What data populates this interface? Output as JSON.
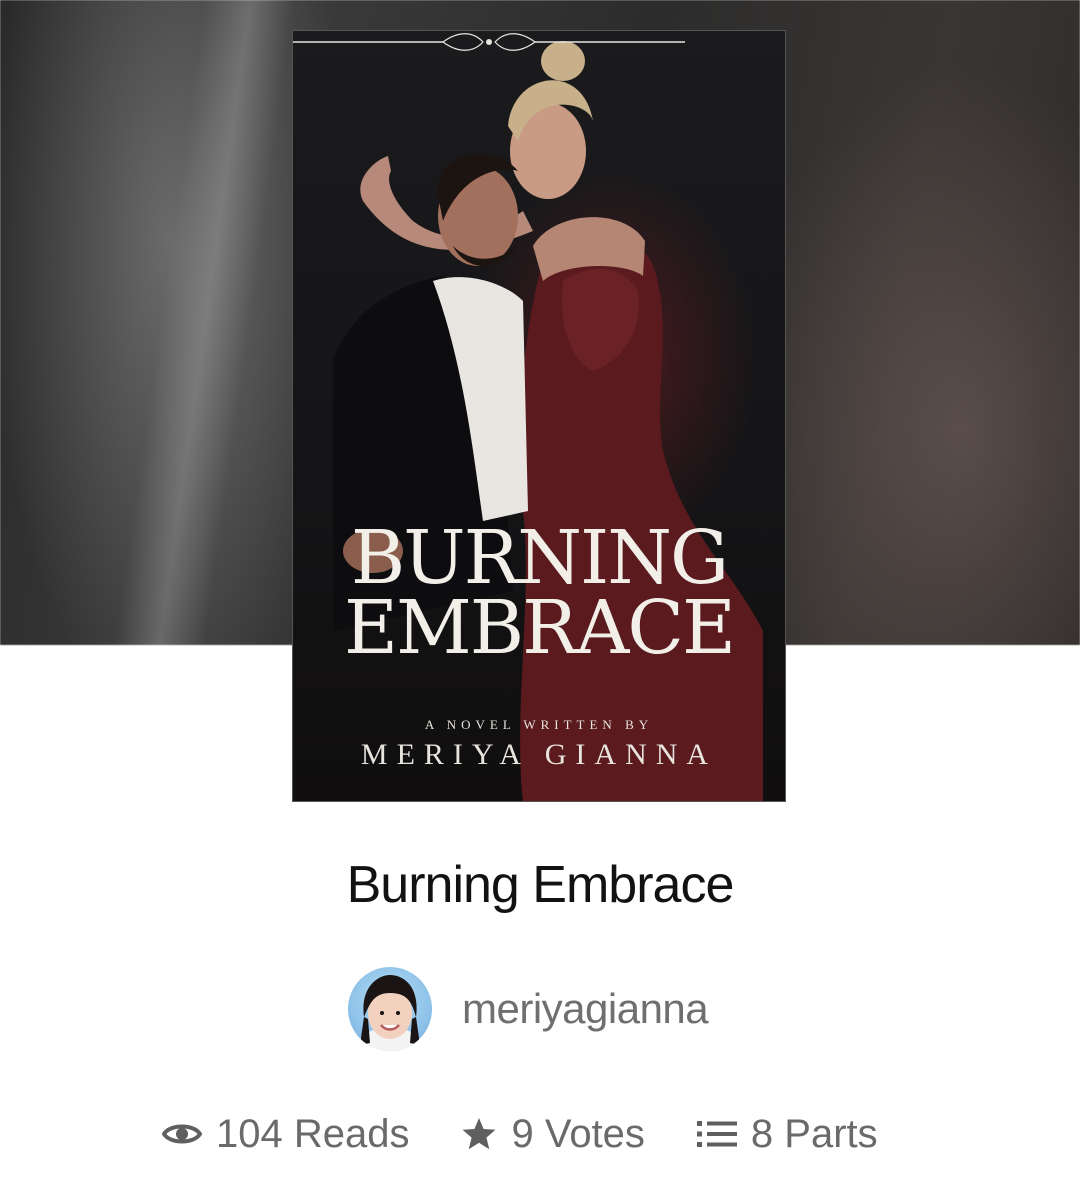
{
  "story": {
    "title": "Burning Embrace",
    "author": "meriyagianna"
  },
  "cover": {
    "title_line1": "BURNING",
    "title_line2": "EMBRACE",
    "byline": "A NOVEL WRITTEN BY",
    "author": "MERIYA GIANNA"
  },
  "stats": {
    "reads": "104 Reads",
    "votes": "9 Votes",
    "parts": "8 Parts"
  },
  "icons": {
    "reads": "eye-icon",
    "votes": "star-icon",
    "parts": "list-icon"
  }
}
